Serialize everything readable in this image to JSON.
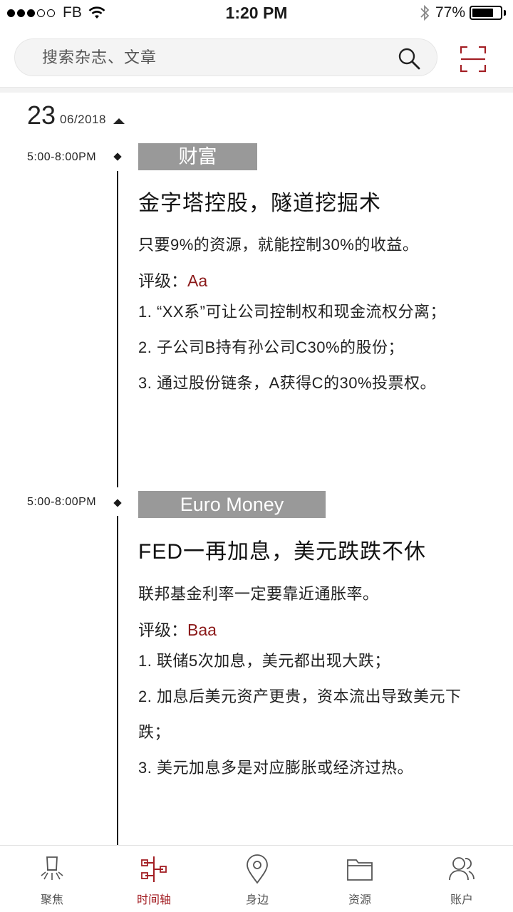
{
  "status_bar": {
    "carrier": "FB",
    "time": "1:20 PM",
    "battery": "77%",
    "battery_level": 0.77
  },
  "search": {
    "placeholder": "搜索杂志、文章"
  },
  "date": {
    "day": "23",
    "month_year": "06/2018"
  },
  "entries": [
    {
      "time": "5:00-8:00PM",
      "source": "财富",
      "title": "金字塔控股，隧道挖掘术",
      "summary": "只要9%的资源，就能控制30%的收益。",
      "rating_label": "评级：",
      "rating_value": "Aa",
      "points": [
        "1. “XX系”可让公司控制权和现金流权分离；",
        "2. 子公司B持有孙公司C30%的股份；",
        "3. 通过股份链条，A获得C的30%投票权。"
      ]
    },
    {
      "time": "5:00-8:00PM",
      "source": "Euro Money",
      "title": "FED一再加息，美元跌跌不休",
      "summary": "联邦基金利率一定要靠近通胀率。",
      "rating_label": "评级：",
      "rating_value": "Baa",
      "points": [
        "1. 联储5次加息，美元都出现大跌；",
        "2. 加息后美元资产更贵，资本流出导致美元下跌；",
        "3. 美元加息多是对应膨胀或经济过热。"
      ]
    }
  ],
  "tabs": [
    {
      "label": "聚焦",
      "icon": "spotlight-icon"
    },
    {
      "label": "时间轴",
      "icon": "timeline-icon",
      "active": true
    },
    {
      "label": "身边",
      "icon": "location-pin-icon"
    },
    {
      "label": "资源",
      "icon": "folder-icon"
    },
    {
      "label": "账户",
      "icon": "users-icon"
    }
  ],
  "colors": {
    "accent": "#a31f24",
    "rating": "#8b1a1a",
    "tag_bg": "#999999"
  }
}
